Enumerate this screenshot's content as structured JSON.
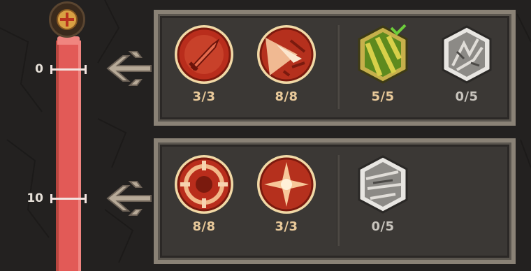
{
  "track": {
    "cap_icon": "cross-emblem-icon",
    "levels": [
      {
        "label": "0"
      },
      {
        "label": "10"
      }
    ]
  },
  "panels": [
    {
      "name": "tier-0",
      "skills": [
        {
          "icon": "sword-slash-icon",
          "count": "3/3",
          "state": "maxed"
        },
        {
          "icon": "burst-strike-icon",
          "count": "8/8",
          "state": "maxed"
        },
        {
          "icon": "nature-gem-icon",
          "count": "5/5",
          "state": "maxed"
        },
        {
          "icon": "locked-stone-icon",
          "count": "0/5",
          "state": "locked"
        }
      ]
    },
    {
      "name": "tier-10",
      "skills": [
        {
          "icon": "target-ring-icon",
          "count": "8/8",
          "state": "maxed"
        },
        {
          "icon": "star-burst-icon",
          "count": "3/3",
          "state": "maxed"
        },
        {
          "icon": "locked-stone-icon",
          "count": "0/5",
          "state": "locked"
        }
      ]
    }
  ],
  "colors": {
    "track": "#e25a57",
    "count_active": "#e8c99a",
    "count_locked": "#c8c4bd",
    "panel_border": "#8a8276"
  }
}
